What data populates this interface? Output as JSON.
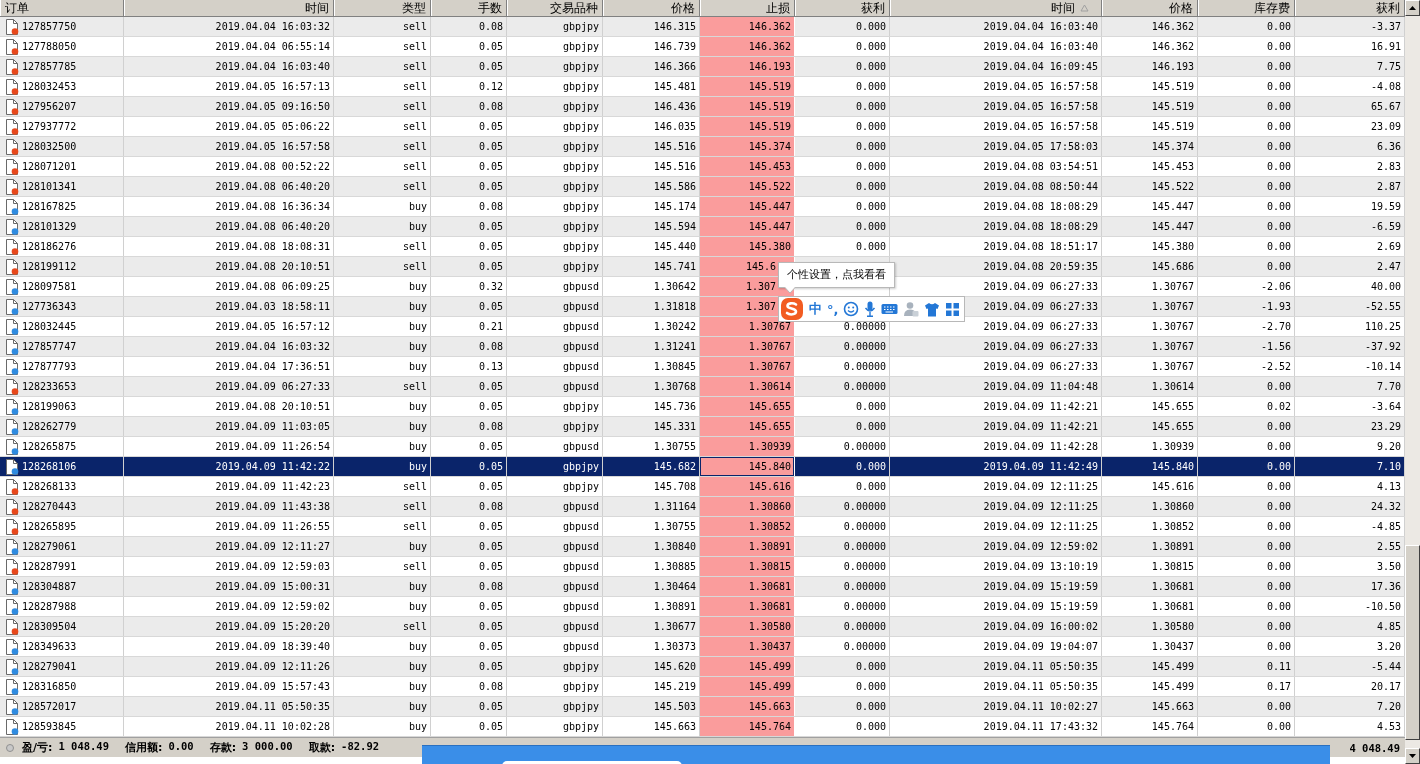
{
  "columns": [
    {
      "label": "订单"
    },
    {
      "label": "时间"
    },
    {
      "label": "类型"
    },
    {
      "label": "手数"
    },
    {
      "label": "交易品种"
    },
    {
      "label": "价格"
    },
    {
      "label": "止损"
    },
    {
      "label": "获利"
    },
    {
      "label": "时间",
      "sorted": true
    },
    {
      "label": "价格"
    },
    {
      "label": "库存费"
    },
    {
      "label": "获利"
    }
  ],
  "rows": [
    {
      "color": "#e8481c",
      "selected": false,
      "cells": [
        "127857750",
        "2019.04.04 16:03:32",
        "sell",
        "0.08",
        "gbpjpy",
        "146.315",
        "146.362",
        "0.000",
        "2019.04.04 16:03:40",
        "146.362",
        "0.00",
        "-3.37"
      ]
    },
    {
      "color": "#e8481c",
      "selected": false,
      "cells": [
        "127788050",
        "2019.04.04 06:55:14",
        "sell",
        "0.05",
        "gbpjpy",
        "146.739",
        "146.362",
        "0.000",
        "2019.04.04 16:03:40",
        "146.362",
        "0.00",
        "16.91"
      ]
    },
    {
      "color": "#e8481c",
      "selected": false,
      "cells": [
        "127857785",
        "2019.04.04 16:03:40",
        "sell",
        "0.05",
        "gbpjpy",
        "146.366",
        "146.193",
        "0.000",
        "2019.04.04 16:09:45",
        "146.193",
        "0.00",
        "7.75"
      ]
    },
    {
      "color": "#e8481c",
      "selected": false,
      "cells": [
        "128032453",
        "2019.04.05 16:57:13",
        "sell",
        "0.12",
        "gbpjpy",
        "145.481",
        "145.519",
        "0.000",
        "2019.04.05 16:57:58",
        "145.519",
        "0.00",
        "-4.08"
      ]
    },
    {
      "color": "#e8481c",
      "selected": false,
      "cells": [
        "127956207",
        "2019.04.05 09:16:50",
        "sell",
        "0.08",
        "gbpjpy",
        "146.436",
        "145.519",
        "0.000",
        "2019.04.05 16:57:58",
        "145.519",
        "0.00",
        "65.67"
      ]
    },
    {
      "color": "#e8481c",
      "selected": false,
      "cells": [
        "127937772",
        "2019.04.05 05:06:22",
        "sell",
        "0.05",
        "gbpjpy",
        "146.035",
        "145.519",
        "0.000",
        "2019.04.05 16:57:58",
        "145.519",
        "0.00",
        "23.09"
      ]
    },
    {
      "color": "#e8481c",
      "selected": false,
      "cells": [
        "128032500",
        "2019.04.05 16:57:58",
        "sell",
        "0.05",
        "gbpjpy",
        "145.516",
        "145.374",
        "0.000",
        "2019.04.05 17:58:03",
        "145.374",
        "0.00",
        "6.36"
      ]
    },
    {
      "color": "#e8481c",
      "selected": false,
      "cells": [
        "128071201",
        "2019.04.08 00:52:22",
        "sell",
        "0.05",
        "gbpjpy",
        "145.516",
        "145.453",
        "0.000",
        "2019.04.08 03:54:51",
        "145.453",
        "0.00",
        "2.83"
      ]
    },
    {
      "color": "#e8481c",
      "selected": false,
      "cells": [
        "128101341",
        "2019.04.08 06:40:20",
        "sell",
        "0.05",
        "gbpjpy",
        "145.586",
        "145.522",
        "0.000",
        "2019.04.08 08:50:44",
        "145.522",
        "0.00",
        "2.87"
      ]
    },
    {
      "color": "#2f8be0",
      "selected": false,
      "cells": [
        "128167825",
        "2019.04.08 16:36:34",
        "buy",
        "0.08",
        "gbpjpy",
        "145.174",
        "145.447",
        "0.000",
        "2019.04.08 18:08:29",
        "145.447",
        "0.00",
        "19.59"
      ]
    },
    {
      "color": "#2f8be0",
      "selected": false,
      "cells": [
        "128101329",
        "2019.04.08 06:40:20",
        "buy",
        "0.05",
        "gbpjpy",
        "145.594",
        "145.447",
        "0.000",
        "2019.04.08 18:08:29",
        "145.447",
        "0.00",
        "-6.59"
      ]
    },
    {
      "color": "#e8481c",
      "selected": false,
      "cells": [
        "128186276",
        "2019.04.08 18:08:31",
        "sell",
        "0.05",
        "gbpjpy",
        "145.440",
        "145.380",
        "0.000",
        "2019.04.08 18:51:17",
        "145.380",
        "0.00",
        "2.69"
      ]
    },
    {
      "color": "#e8481c",
      "selected": false,
      "covered": true,
      "cells": [
        "128199112",
        "2019.04.08 20:10:51",
        "sell",
        "0.05",
        "gbpjpy",
        "145.741",
        "145.6",
        null,
        "2019.04.08 20:59:35",
        "145.686",
        "0.00",
        "2.47"
      ]
    },
    {
      "color": "#2f8be0",
      "selected": false,
      "covered": true,
      "cells": [
        "128097581",
        "2019.04.08 06:09:25",
        "buy",
        "0.32",
        "gbpusd",
        "1.30642",
        "1.307",
        null,
        "2019.04.09 06:27:33",
        "1.30767",
        "-2.06",
        "40.00"
      ]
    },
    {
      "color": "#2f8be0",
      "selected": false,
      "covered": true,
      "cells": [
        "127736343",
        "2019.04.03 18:58:11",
        "buy",
        "0.05",
        "gbpusd",
        "1.31818",
        "1.307",
        null,
        "2019.04.09 06:27:33",
        "1.30767",
        "-1.93",
        "-52.55"
      ]
    },
    {
      "color": "#2f8be0",
      "selected": false,
      "cells": [
        "128032445",
        "2019.04.05 16:57:12",
        "buy",
        "0.21",
        "gbpusd",
        "1.30242",
        "1.30767",
        "0.00000",
        "2019.04.09 06:27:33",
        "1.30767",
        "-2.70",
        "110.25"
      ]
    },
    {
      "color": "#2f8be0",
      "selected": false,
      "cells": [
        "127857747",
        "2019.04.04 16:03:32",
        "buy",
        "0.08",
        "gbpusd",
        "1.31241",
        "1.30767",
        "0.00000",
        "2019.04.09 06:27:33",
        "1.30767",
        "-1.56",
        "-37.92"
      ]
    },
    {
      "color": "#2f8be0",
      "selected": false,
      "cells": [
        "127877793",
        "2019.04.04 17:36:51",
        "buy",
        "0.13",
        "gbpusd",
        "1.30845",
        "1.30767",
        "0.00000",
        "2019.04.09 06:27:33",
        "1.30767",
        "-2.52",
        "-10.14"
      ]
    },
    {
      "color": "#e8481c",
      "selected": false,
      "cells": [
        "128233653",
        "2019.04.09 06:27:33",
        "sell",
        "0.05",
        "gbpusd",
        "1.30768",
        "1.30614",
        "0.00000",
        "2019.04.09 11:04:48",
        "1.30614",
        "0.00",
        "7.70"
      ]
    },
    {
      "color": "#2f8be0",
      "selected": false,
      "cells": [
        "128199063",
        "2019.04.08 20:10:51",
        "buy",
        "0.05",
        "gbpjpy",
        "145.736",
        "145.655",
        "0.000",
        "2019.04.09 11:42:21",
        "145.655",
        "0.02",
        "-3.64"
      ]
    },
    {
      "color": "#2f8be0",
      "selected": false,
      "cells": [
        "128262779",
        "2019.04.09 11:03:05",
        "buy",
        "0.08",
        "gbpjpy",
        "145.331",
        "145.655",
        "0.000",
        "2019.04.09 11:42:21",
        "145.655",
        "0.00",
        "23.29"
      ]
    },
    {
      "color": "#2f8be0",
      "selected": false,
      "cells": [
        "128265875",
        "2019.04.09 11:26:54",
        "buy",
        "0.05",
        "gbpusd",
        "1.30755",
        "1.30939",
        "0.00000",
        "2019.04.09 11:42:28",
        "1.30939",
        "0.00",
        "9.20"
      ]
    },
    {
      "color": "#2f8be0",
      "selected": true,
      "cells": [
        "128268106",
        "2019.04.09 11:42:22",
        "buy",
        "0.05",
        "gbpjpy",
        "145.682",
        "145.840",
        "0.000",
        "2019.04.09 11:42:49",
        "145.840",
        "0.00",
        "7.10"
      ]
    },
    {
      "color": "#e8481c",
      "selected": false,
      "cells": [
        "128268133",
        "2019.04.09 11:42:23",
        "sell",
        "0.05",
        "gbpjpy",
        "145.708",
        "145.616",
        "0.000",
        "2019.04.09 12:11:25",
        "145.616",
        "0.00",
        "4.13"
      ]
    },
    {
      "color": "#e8481c",
      "selected": false,
      "cells": [
        "128270443",
        "2019.04.09 11:43:38",
        "sell",
        "0.08",
        "gbpusd",
        "1.31164",
        "1.30860",
        "0.00000",
        "2019.04.09 12:11:25",
        "1.30860",
        "0.00",
        "24.32"
      ]
    },
    {
      "color": "#e8481c",
      "selected": false,
      "cells": [
        "128265895",
        "2019.04.09 11:26:55",
        "sell",
        "0.05",
        "gbpusd",
        "1.30755",
        "1.30852",
        "0.00000",
        "2019.04.09 12:11:25",
        "1.30852",
        "0.00",
        "-4.85"
      ]
    },
    {
      "color": "#2f8be0",
      "selected": false,
      "cells": [
        "128279061",
        "2019.04.09 12:11:27",
        "buy",
        "0.05",
        "gbpusd",
        "1.30840",
        "1.30891",
        "0.00000",
        "2019.04.09 12:59:02",
        "1.30891",
        "0.00",
        "2.55"
      ]
    },
    {
      "color": "#e8481c",
      "selected": false,
      "cells": [
        "128287991",
        "2019.04.09 12:59:03",
        "sell",
        "0.05",
        "gbpusd",
        "1.30885",
        "1.30815",
        "0.00000",
        "2019.04.09 13:10:19",
        "1.30815",
        "0.00",
        "3.50"
      ]
    },
    {
      "color": "#2f8be0",
      "selected": false,
      "cells": [
        "128304887",
        "2019.04.09 15:00:31",
        "buy",
        "0.08",
        "gbpusd",
        "1.30464",
        "1.30681",
        "0.00000",
        "2019.04.09 15:19:59",
        "1.30681",
        "0.00",
        "17.36"
      ]
    },
    {
      "color": "#2f8be0",
      "selected": false,
      "cells": [
        "128287988",
        "2019.04.09 12:59:02",
        "buy",
        "0.05",
        "gbpusd",
        "1.30891",
        "1.30681",
        "0.00000",
        "2019.04.09 15:19:59",
        "1.30681",
        "0.00",
        "-10.50"
      ]
    },
    {
      "color": "#e8481c",
      "selected": false,
      "cells": [
        "128309504",
        "2019.04.09 15:20:20",
        "sell",
        "0.05",
        "gbpusd",
        "1.30677",
        "1.30580",
        "0.00000",
        "2019.04.09 16:00:02",
        "1.30580",
        "0.00",
        "4.85"
      ]
    },
    {
      "color": "#2f8be0",
      "selected": false,
      "cells": [
        "128349633",
        "2019.04.09 18:39:40",
        "buy",
        "0.05",
        "gbpusd",
        "1.30373",
        "1.30437",
        "0.00000",
        "2019.04.09 19:04:07",
        "1.30437",
        "0.00",
        "3.20"
      ]
    },
    {
      "color": "#2f8be0",
      "selected": false,
      "cells": [
        "128279041",
        "2019.04.09 12:11:26",
        "buy",
        "0.05",
        "gbpjpy",
        "145.620",
        "145.499",
        "0.000",
        "2019.04.11 05:50:35",
        "145.499",
        "0.11",
        "-5.44"
      ]
    },
    {
      "color": "#2f8be0",
      "selected": false,
      "cells": [
        "128316850",
        "2019.04.09 15:57:43",
        "buy",
        "0.08",
        "gbpjpy",
        "145.219",
        "145.499",
        "0.000",
        "2019.04.11 05:50:35",
        "145.499",
        "0.17",
        "20.17"
      ]
    },
    {
      "color": "#2f8be0",
      "selected": false,
      "cells": [
        "128572017",
        "2019.04.11 05:50:35",
        "buy",
        "0.05",
        "gbpjpy",
        "145.503",
        "145.663",
        "0.000",
        "2019.04.11 10:02:27",
        "145.663",
        "0.00",
        "7.20"
      ]
    },
    {
      "color": "#2f8be0",
      "selected": false,
      "cells": [
        "128593845",
        "2019.04.11 10:02:28",
        "buy",
        "0.05",
        "gbpjpy",
        "145.663",
        "145.764",
        "0.000",
        "2019.04.11 17:43:32",
        "145.764",
        "0.00",
        "4.53"
      ]
    }
  ],
  "status_bar": {
    "items": [
      {
        "label": "盈/亏:",
        "value": "1 048.49"
      },
      {
        "label": "信用额:",
        "value": "0.00"
      },
      {
        "label": "存款:",
        "value": "3 000.00"
      },
      {
        "label": "取款:",
        "value": "-82.92"
      }
    ],
    "total": "4 048.49"
  },
  "ime_tooltip": {
    "text": "个性设置，点我看看"
  },
  "ime_toolbar": {
    "mode": "中",
    "punctuation": "°,"
  }
}
